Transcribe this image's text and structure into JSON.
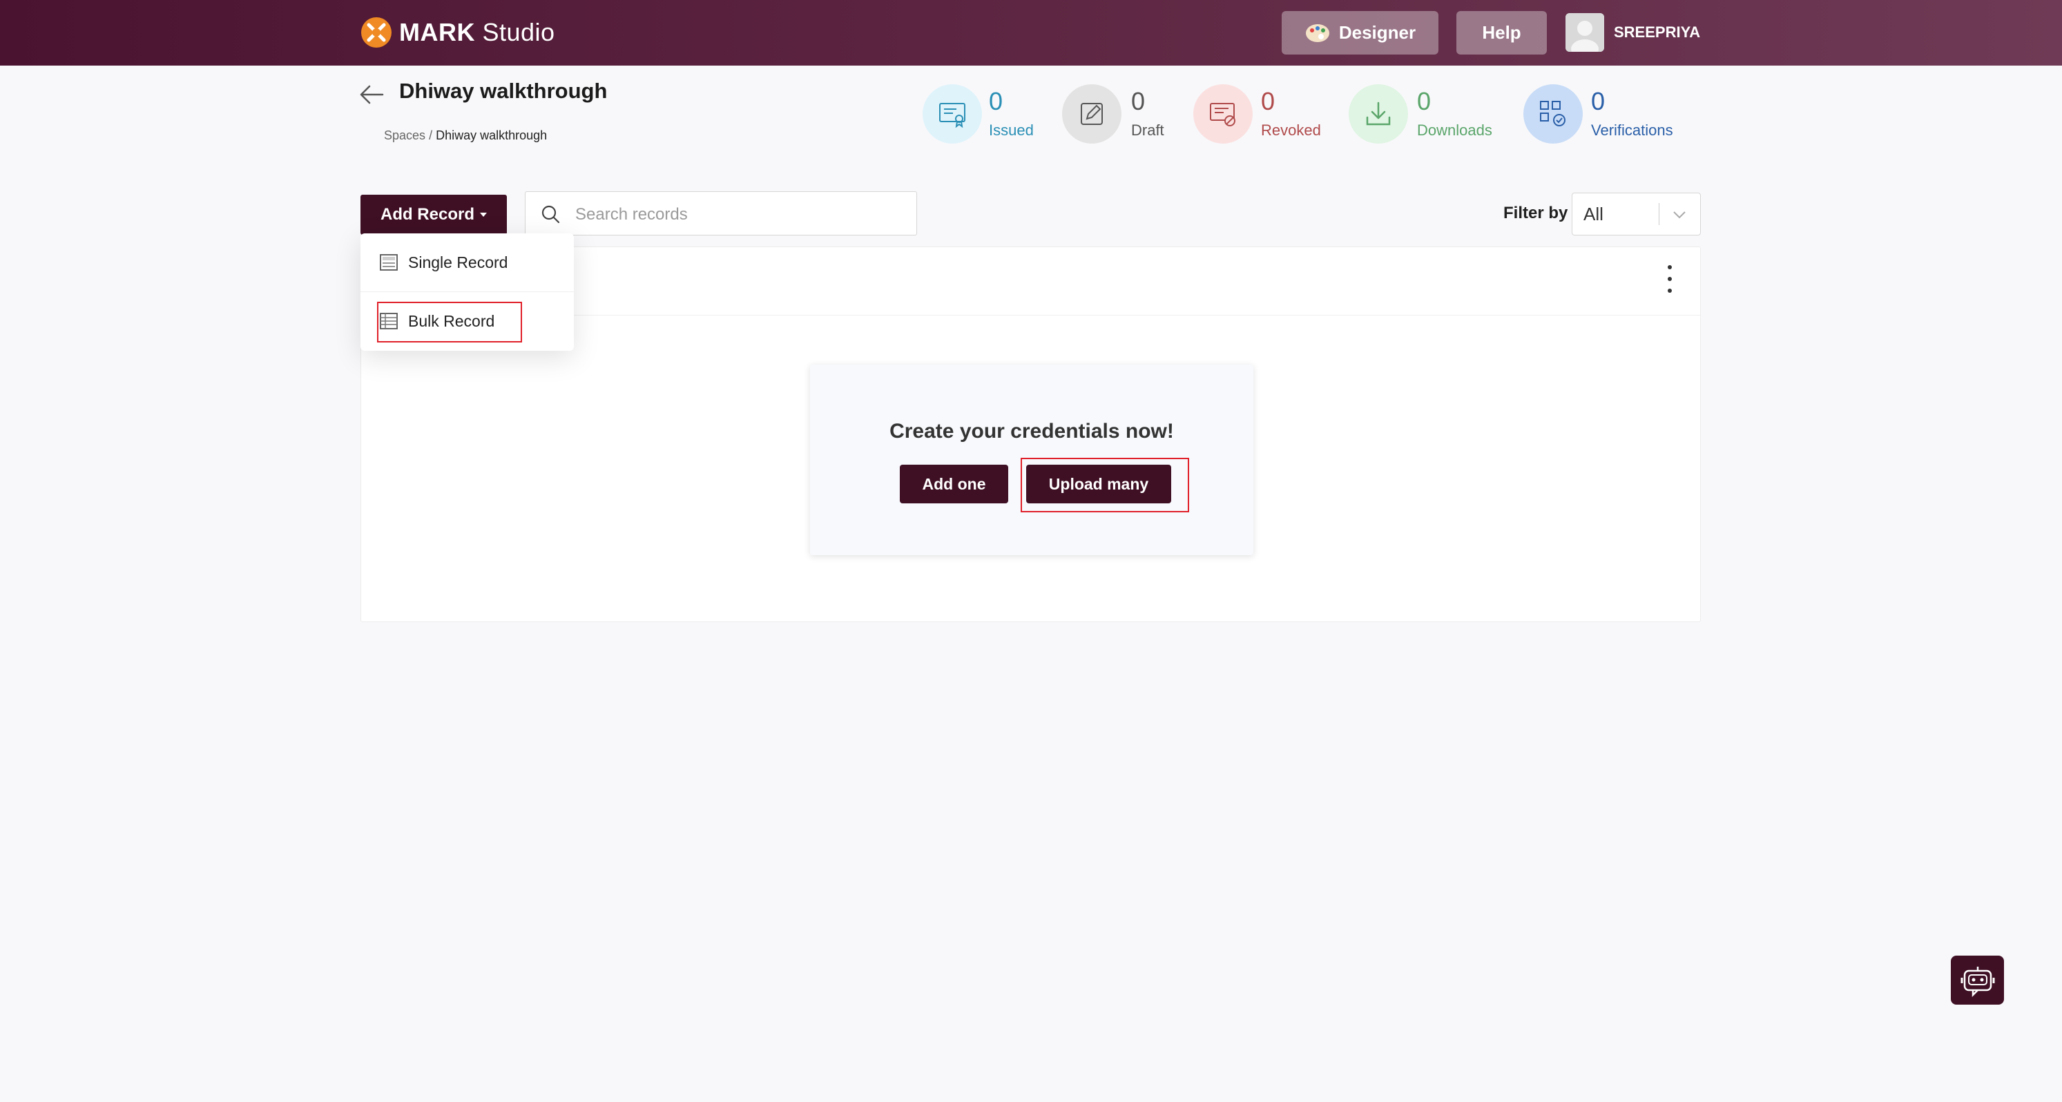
{
  "header": {
    "logo_brand": "MARK",
    "logo_product": "Studio",
    "designer_label": "Designer",
    "help_label": "Help",
    "username": "SREEPRIYA"
  },
  "page": {
    "title": "Dhiway walkthrough",
    "breadcrumb": {
      "root": "Spaces",
      "sep": "/",
      "current": "Dhiway walkthrough"
    }
  },
  "stats": [
    {
      "label": "Issued",
      "value": "0",
      "color": "#2a8fb5",
      "bg": "#dff3fb",
      "icon": "certificate-icon"
    },
    {
      "label": "Draft",
      "value": "0",
      "color": "#555555",
      "bg": "#e3e3e3",
      "icon": "edit-icon"
    },
    {
      "label": "Revoked",
      "value": "0",
      "color": "#b04a4a",
      "bg": "#fbe0e0",
      "icon": "revoke-icon"
    },
    {
      "label": "Downloads",
      "value": "0",
      "color": "#5aa56a",
      "bg": "#e0f5e3",
      "icon": "download-icon"
    },
    {
      "label": "Verifications",
      "value": "0",
      "color": "#2a5fa8",
      "bg": "#c8dcf7",
      "icon": "verify-icon"
    }
  ],
  "toolbar": {
    "add_record_label": "Add Record",
    "search_placeholder": "Search records",
    "filter_label": "Filter by",
    "filter_value": "All"
  },
  "dropdown": {
    "items": [
      {
        "label": "Single Record"
      },
      {
        "label": "Bulk Record"
      }
    ]
  },
  "empty_state": {
    "title": "Create your credentials now!",
    "add_one_label": "Add one",
    "upload_many_label": "Upload many"
  },
  "colors": {
    "primary": "#3f1024",
    "header_start": "#4a1430",
    "header_end": "#6e3a55",
    "highlight": "#e0202a"
  }
}
